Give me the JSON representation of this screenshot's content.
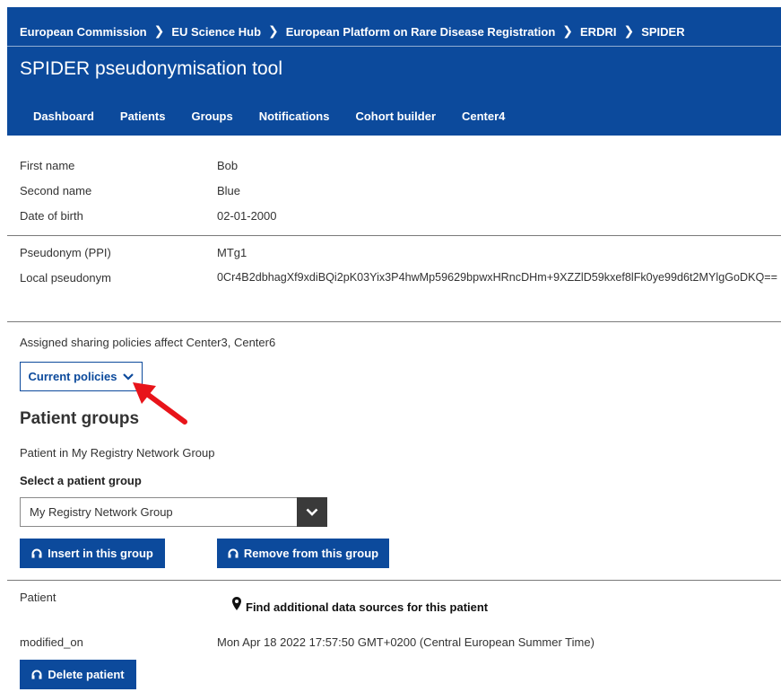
{
  "breadcrumb": [
    "European Commission",
    "EU Science Hub",
    "European Platform on Rare Disease Registration",
    "ERDRI",
    "SPIDER"
  ],
  "app": {
    "title": "SPIDER pseudonymisation tool"
  },
  "nav": [
    "Dashboard",
    "Patients",
    "Groups",
    "Notifications",
    "Cohort builder",
    "Center4"
  ],
  "patient": {
    "first_name_label": "First name",
    "first_name": "Bob",
    "second_name_label": "Second name",
    "second_name": "Blue",
    "dob_label": "Date of birth",
    "dob": "02-01-2000",
    "ppi_label": "Pseudonym (PPI)",
    "ppi": "MTg1",
    "local_label": "Local pseudonym",
    "local": "0Cr4B2dbhagXf9xdiBQi2pK03Yix3P4hwMp59629bpwxHRncDHm+9XZZlD59kxef8lFk0ye99d6t2MYlgGoDKQ=="
  },
  "policies": {
    "text": "Assigned sharing policies affect Center3, Center6",
    "button_label": "Current policies"
  },
  "groups": {
    "title": "Patient groups",
    "membership": "Patient in My Registry Network Group",
    "select_label": "Select a patient group",
    "selected": "My Registry Network Group",
    "insert_label": "Insert in this group",
    "remove_label": "Remove from this group"
  },
  "footer": {
    "patient_label": "Patient",
    "find_label": "Find additional data sources for this patient",
    "modified_label": "modified_on",
    "modified_value": "Mon Apr 18 2022 17:57:50 GMT+0200 (Central European Summer Time)",
    "delete_label": "Delete patient"
  },
  "colors": {
    "brand": "#0c4a9c",
    "arrow": "#e8141a",
    "select_arrow_bg": "#3a3a3a"
  }
}
